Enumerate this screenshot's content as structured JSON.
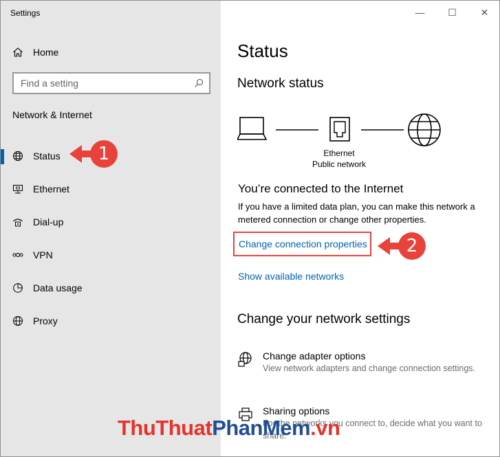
{
  "app": {
    "title": "Settings"
  },
  "window_controls": {
    "minimize": "—",
    "maximize": "☐",
    "close": "✕"
  },
  "sidebar": {
    "home_label": "Home",
    "search_placeholder": "Find a setting",
    "section_title": "Network & Internet",
    "items": [
      {
        "label": "Status",
        "icon": "globe-icon",
        "active": true
      },
      {
        "label": "Ethernet",
        "icon": "ethernet-icon"
      },
      {
        "label": "Dial-up",
        "icon": "dialup-icon"
      },
      {
        "label": "VPN",
        "icon": "vpn-icon"
      },
      {
        "label": "Data usage",
        "icon": "data-usage-icon"
      },
      {
        "label": "Proxy",
        "icon": "globe-icon"
      }
    ]
  },
  "callouts": {
    "one": "1",
    "two": "2",
    "color": "#e8423a"
  },
  "main": {
    "page_title": "Status",
    "network_status_heading": "Network status",
    "diagram": {
      "adapter_name": "Ethernet",
      "network_type": "Public network"
    },
    "connected_heading": "You’re connected to the Internet",
    "connected_desc_line1": "If you have a limited data plan, you can make this network a",
    "connected_desc_line2": "metered connection or change other properties.",
    "link_change_properties": "Change connection properties",
    "link_show_networks": "Show available networks",
    "change_settings_heading": "Change your network settings",
    "options": [
      {
        "title": "Change adapter options",
        "desc": "View network adapters and change connection settings.",
        "icon": "adapter-globe-icon"
      },
      {
        "title": "Sharing options",
        "desc": "For the networks you connect to, decide what you want to share.",
        "icon": "sharing-icon"
      }
    ]
  },
  "watermark": {
    "part1": "ThuThuat",
    "part2": "PhanMem",
    "part3": ".vn"
  },
  "colors": {
    "accent": "#0063b1",
    "sidebar_bg": "#e6e6e6"
  }
}
